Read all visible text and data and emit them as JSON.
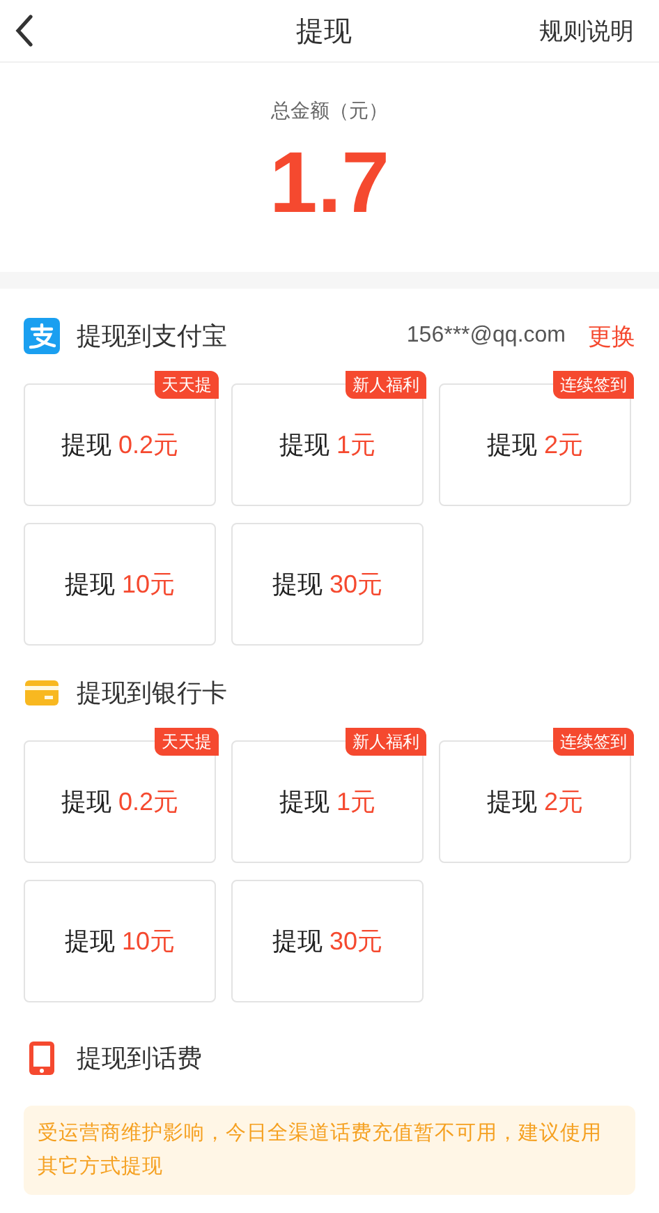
{
  "header": {
    "title": "提现",
    "action": "规则说明"
  },
  "total": {
    "label": "总金额（元）",
    "amount": "1.7"
  },
  "sections": [
    {
      "kind": "alipay",
      "title": "提现到支付宝",
      "account": "156***@qq.com",
      "change": "更换",
      "options": [
        {
          "label": "提现",
          "amount": "0.2元",
          "badge": "天天提"
        },
        {
          "label": "提现",
          "amount": "1元",
          "badge": "新人福利"
        },
        {
          "label": "提现",
          "amount": "2元",
          "badge": "连续签到"
        },
        {
          "label": "提现",
          "amount": "10元"
        },
        {
          "label": "提现",
          "amount": "30元"
        }
      ]
    },
    {
      "kind": "bank",
      "title": "提现到银行卡",
      "options": [
        {
          "label": "提现",
          "amount": "0.2元",
          "badge": "天天提"
        },
        {
          "label": "提现",
          "amount": "1元",
          "badge": "新人福利"
        },
        {
          "label": "提现",
          "amount": "2元",
          "badge": "连续签到"
        },
        {
          "label": "提现",
          "amount": "10元"
        },
        {
          "label": "提现",
          "amount": "30元"
        }
      ]
    },
    {
      "kind": "phone",
      "title": "提现到话费",
      "notice": "受运营商维护影响，今日全渠道话费充值暂不可用，建议使用其它方式提现"
    }
  ]
}
